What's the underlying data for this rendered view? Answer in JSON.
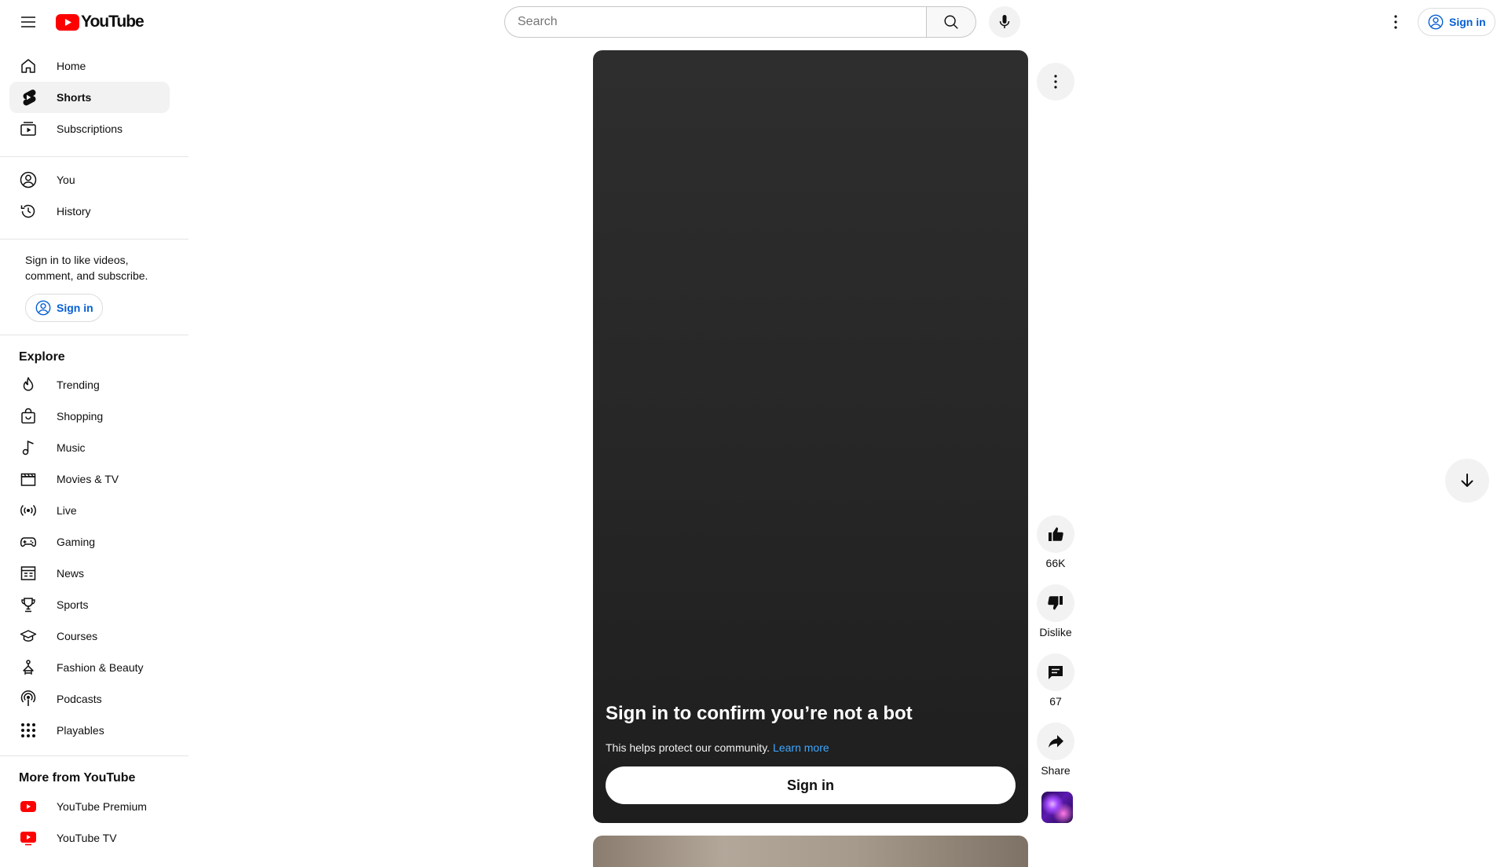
{
  "masthead": {
    "logo_text": "YouTube",
    "search_placeholder": "Search",
    "sign_in": "Sign in"
  },
  "sidebar": {
    "primary": [
      {
        "label": "Home",
        "icon": "home-icon"
      },
      {
        "label": "Shorts",
        "icon": "shorts-icon",
        "active": true
      },
      {
        "label": "Subscriptions",
        "icon": "subscriptions-icon"
      }
    ],
    "you": [
      {
        "label": "You",
        "icon": "account-circle-icon"
      },
      {
        "label": "History",
        "icon": "history-icon"
      }
    ],
    "signin_prompt": "Sign in to like videos, comment, and subscribe.",
    "signin_button": "Sign in",
    "explore_title": "Explore",
    "explore": [
      {
        "label": "Trending",
        "icon": "trending-icon"
      },
      {
        "label": "Shopping",
        "icon": "shopping-bag-icon"
      },
      {
        "label": "Music",
        "icon": "music-note-icon"
      },
      {
        "label": "Movies & TV",
        "icon": "clapperboard-icon"
      },
      {
        "label": "Live",
        "icon": "live-icon"
      },
      {
        "label": "Gaming",
        "icon": "gamepad-icon"
      },
      {
        "label": "News",
        "icon": "newspaper-icon"
      },
      {
        "label": "Sports",
        "icon": "trophy-icon"
      },
      {
        "label": "Courses",
        "icon": "graduation-cap-icon"
      },
      {
        "label": "Fashion & Beauty",
        "icon": "hanger-icon"
      },
      {
        "label": "Podcasts",
        "icon": "podcast-icon"
      },
      {
        "label": "Playables",
        "icon": "grid-dots-icon"
      }
    ],
    "more_title": "More from YouTube",
    "more": [
      {
        "label": "YouTube Premium",
        "icon": "youtube-premium-icon"
      },
      {
        "label": "YouTube TV",
        "icon": "youtube-tv-icon"
      }
    ]
  },
  "player": {
    "title": "Sign in to confirm you’re not a bot",
    "subtitle": "This helps protect our community.",
    "learn_more": "Learn more",
    "sign_in_button": "Sign in"
  },
  "actions": {
    "like_count": "66K",
    "dislike_label": "Dislike",
    "comment_count": "67",
    "share_label": "Share"
  },
  "colors": {
    "brand_red": "#ff0000",
    "link_blue": "#065fd4",
    "learn_more_blue": "#3ea6ff",
    "active_bg": "#f2f2f2",
    "player_bg": "#262626"
  }
}
